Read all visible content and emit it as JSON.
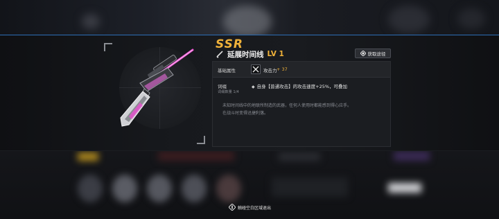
{
  "item": {
    "rarity": "SSR",
    "name": "延展时间线",
    "level": "LV 1",
    "source_button": "获取途径"
  },
  "base_attr": {
    "label": "基础属性",
    "stat_name": "攻击力",
    "stat_value": "+ 37"
  },
  "affix": {
    "label": "词缀",
    "count": "词缀数量 1/4",
    "text": "自身【普通攻击】的攻击速度+25%，可叠加"
  },
  "description": [
    "未知时间线中的地联所制造的武器，任何人使用时都能感到得心应手。",
    "在战斗时变得迅捷利落。"
  ],
  "hint": "触碰空白区域退出",
  "colors": {
    "accent_gold": "#f0b23a",
    "accent_blue": "#2d6fb8",
    "weapon_pink": "#e84fd0"
  }
}
